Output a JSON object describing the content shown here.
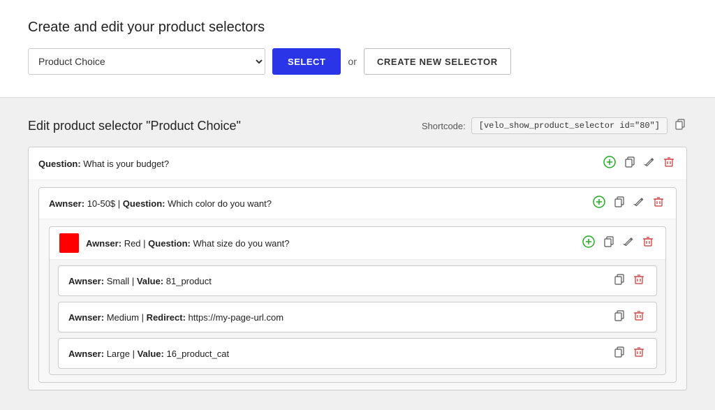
{
  "top": {
    "title": "Create and edit your product selectors",
    "dropdown_value": "Product Choice",
    "btn_select_label": "SELECT",
    "or_text": "or",
    "btn_create_label": "CREATE NEW SELECTOR"
  },
  "bottom": {
    "edit_title": "Edit product selector \"Product Choice\"",
    "shortcode_label": "Shortcode:",
    "shortcode_value": "[velo_show_product_selector id=\"80\"]",
    "question1": {
      "label": "Question:",
      "text": "What is your budget?",
      "answer1": {
        "answer_label": "Awnser:",
        "answer_text": "10-50$",
        "question_label": "Question:",
        "question_text": "Which color do you want?",
        "color_swatch_color": "#ff0000",
        "answer2": {
          "answer_label": "Awnser:",
          "answer_text": "Red",
          "question_label": "Question:",
          "question_text": "What size do you want?",
          "size_rows": [
            {
              "answer_label": "Awnser:",
              "answer_text": "Small",
              "pipe": "|",
              "value_label": "Value:",
              "value_text": "81_product"
            },
            {
              "answer_label": "Awnser:",
              "answer_text": "Medium",
              "pipe": "|",
              "value_label": "Redirect:",
              "value_text": "https://my-page-url.com"
            },
            {
              "answer_label": "Awnser:",
              "answer_text": "Large",
              "pipe": "|",
              "value_label": "Value:",
              "value_text": "16_product_cat"
            }
          ]
        }
      }
    }
  },
  "icons": {
    "plus": "⊕",
    "copy": "⧉",
    "edit": "✎",
    "delete": "🗑",
    "clipboard": "⧉"
  }
}
